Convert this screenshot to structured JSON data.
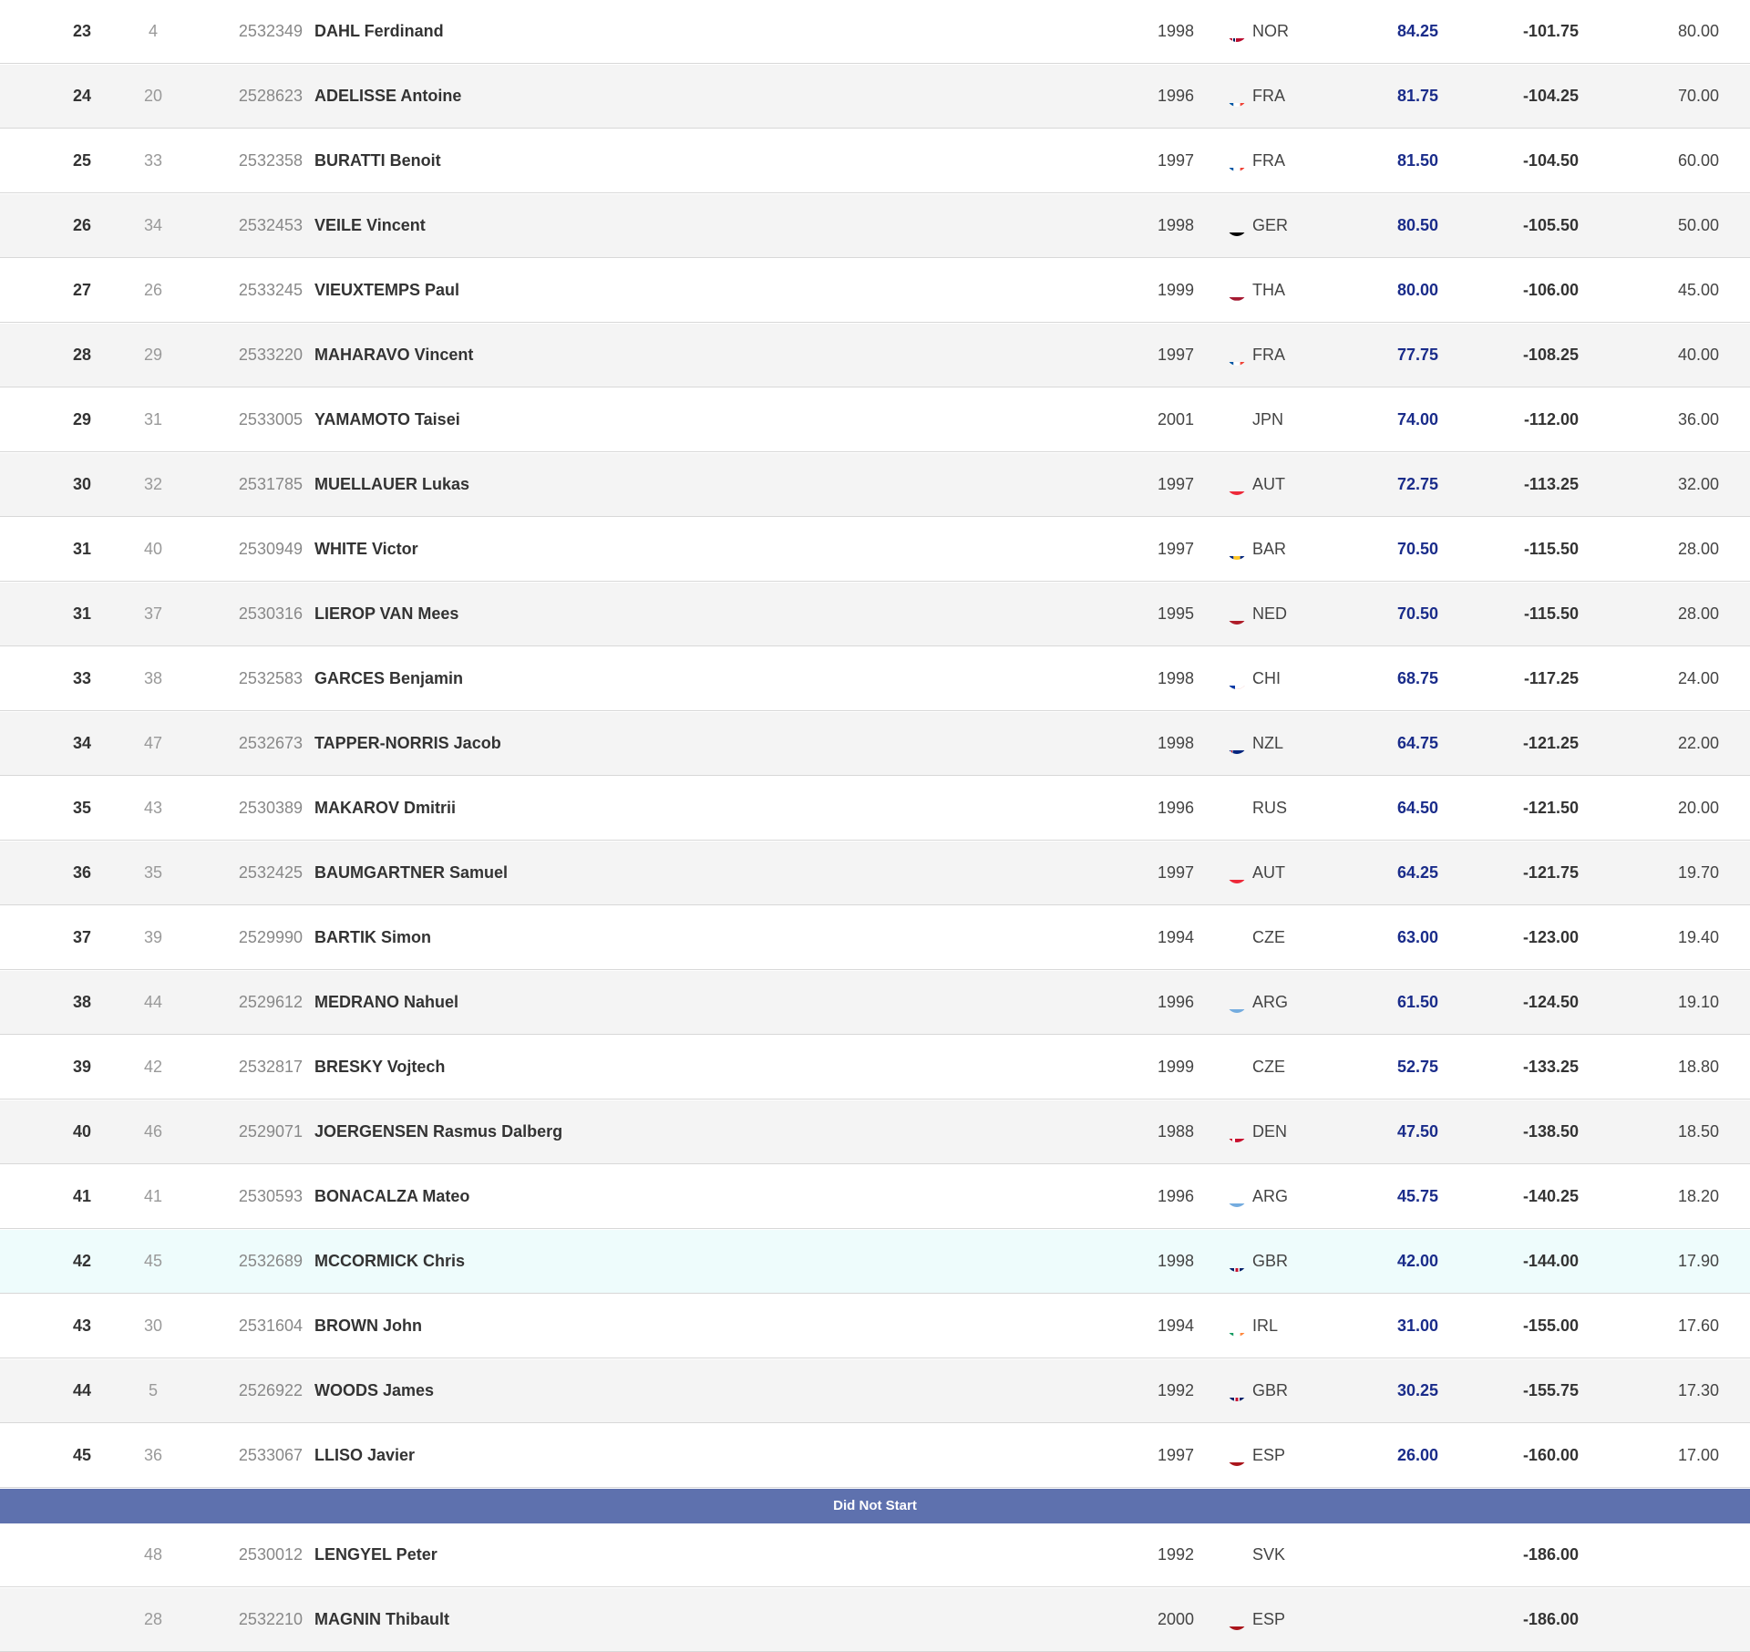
{
  "ranked": [
    {
      "rank": "23",
      "bib": "4",
      "code": "2532349",
      "name": "DAHL Ferdinand",
      "yob": "1998",
      "nation": "NOR",
      "points": "84.25",
      "diff": "-101.75",
      "fis": "80.00"
    },
    {
      "rank": "24",
      "bib": "20",
      "code": "2528623",
      "name": "ADELISSE Antoine",
      "yob": "1996",
      "nation": "FRA",
      "points": "81.75",
      "diff": "-104.25",
      "fis": "70.00"
    },
    {
      "rank": "25",
      "bib": "33",
      "code": "2532358",
      "name": "BURATTI Benoit",
      "yob": "1997",
      "nation": "FRA",
      "points": "81.50",
      "diff": "-104.50",
      "fis": "60.00"
    },
    {
      "rank": "26",
      "bib": "34",
      "code": "2532453",
      "name": "VEILE Vincent",
      "yob": "1998",
      "nation": "GER",
      "points": "80.50",
      "diff": "-105.50",
      "fis": "50.00"
    },
    {
      "rank": "27",
      "bib": "26",
      "code": "2533245",
      "name": "VIEUXTEMPS Paul",
      "yob": "1999",
      "nation": "THA",
      "points": "80.00",
      "diff": "-106.00",
      "fis": "45.00"
    },
    {
      "rank": "28",
      "bib": "29",
      "code": "2533220",
      "name": "MAHARAVO Vincent",
      "yob": "1997",
      "nation": "FRA",
      "points": "77.75",
      "diff": "-108.25",
      "fis": "40.00"
    },
    {
      "rank": "29",
      "bib": "31",
      "code": "2533005",
      "name": "YAMAMOTO Taisei",
      "yob": "2001",
      "nation": "JPN",
      "points": "74.00",
      "diff": "-112.00",
      "fis": "36.00"
    },
    {
      "rank": "30",
      "bib": "32",
      "code": "2531785",
      "name": "MUELLAUER Lukas",
      "yob": "1997",
      "nation": "AUT",
      "points": "72.75",
      "diff": "-113.25",
      "fis": "32.00"
    },
    {
      "rank": "31",
      "bib": "40",
      "code": "2530949",
      "name": "WHITE Victor",
      "yob": "1997",
      "nation": "BAR",
      "points": "70.50",
      "diff": "-115.50",
      "fis": "28.00"
    },
    {
      "rank": "31",
      "bib": "37",
      "code": "2530316",
      "name": "LIEROP VAN Mees",
      "yob": "1995",
      "nation": "NED",
      "points": "70.50",
      "diff": "-115.50",
      "fis": "28.00"
    },
    {
      "rank": "33",
      "bib": "38",
      "code": "2532583",
      "name": "GARCES Benjamin",
      "yob": "1998",
      "nation": "CHI",
      "points": "68.75",
      "diff": "-117.25",
      "fis": "24.00"
    },
    {
      "rank": "34",
      "bib": "47",
      "code": "2532673",
      "name": "TAPPER-NORRIS Jacob",
      "yob": "1998",
      "nation": "NZL",
      "points": "64.75",
      "diff": "-121.25",
      "fis": "22.00"
    },
    {
      "rank": "35",
      "bib": "43",
      "code": "2530389",
      "name": "MAKAROV Dmitrii",
      "yob": "1996",
      "nation": "RUS",
      "points": "64.50",
      "diff": "-121.50",
      "fis": "20.00"
    },
    {
      "rank": "36",
      "bib": "35",
      "code": "2532425",
      "name": "BAUMGARTNER Samuel",
      "yob": "1997",
      "nation": "AUT",
      "points": "64.25",
      "diff": "-121.75",
      "fis": "19.70"
    },
    {
      "rank": "37",
      "bib": "39",
      "code": "2529990",
      "name": "BARTIK Simon",
      "yob": "1994",
      "nation": "CZE",
      "points": "63.00",
      "diff": "-123.00",
      "fis": "19.40"
    },
    {
      "rank": "38",
      "bib": "44",
      "code": "2529612",
      "name": "MEDRANO Nahuel",
      "yob": "1996",
      "nation": "ARG",
      "points": "61.50",
      "diff": "-124.50",
      "fis": "19.10"
    },
    {
      "rank": "39",
      "bib": "42",
      "code": "2532817",
      "name": "BRESKY Vojtech",
      "yob": "1999",
      "nation": "CZE",
      "points": "52.75",
      "diff": "-133.25",
      "fis": "18.80"
    },
    {
      "rank": "40",
      "bib": "46",
      "code": "2529071",
      "name": "JOERGENSEN Rasmus Dalberg",
      "yob": "1988",
      "nation": "DEN",
      "points": "47.50",
      "diff": "-138.50",
      "fis": "18.50"
    },
    {
      "rank": "41",
      "bib": "41",
      "code": "2530593",
      "name": "BONACALZA Mateo",
      "yob": "1996",
      "nation": "ARG",
      "points": "45.75",
      "diff": "-140.25",
      "fis": "18.20"
    },
    {
      "rank": "42",
      "bib": "45",
      "code": "2532689",
      "name": "MCCORMICK Chris",
      "yob": "1998",
      "nation": "GBR",
      "points": "42.00",
      "diff": "-144.00",
      "fis": "17.90",
      "highlight": true
    },
    {
      "rank": "43",
      "bib": "30",
      "code": "2531604",
      "name": "BROWN John",
      "yob": "1994",
      "nation": "IRL",
      "points": "31.00",
      "diff": "-155.00",
      "fis": "17.60"
    },
    {
      "rank": "44",
      "bib": "5",
      "code": "2526922",
      "name": "WOODS James",
      "yob": "1992",
      "nation": "GBR",
      "points": "30.25",
      "diff": "-155.75",
      "fis": "17.30"
    },
    {
      "rank": "45",
      "bib": "36",
      "code": "2533067",
      "name": "LLISO Javier",
      "yob": "1997",
      "nation": "ESP",
      "points": "26.00",
      "diff": "-160.00",
      "fis": "17.00"
    }
  ],
  "dns_label": "Did Not Start",
  "dns": [
    {
      "rank": "",
      "bib": "48",
      "code": "2530012",
      "name": "LENGYEL Peter",
      "yob": "1992",
      "nation": "SVK",
      "points": "",
      "diff": "-186.00",
      "fis": ""
    },
    {
      "rank": "",
      "bib": "28",
      "code": "2532210",
      "name": "MAGNIN Thibault",
      "yob": "2000",
      "nation": "ESP",
      "points": "",
      "diff": "-186.00",
      "fis": ""
    }
  ],
  "colors": {
    "points": "#1a2c8a",
    "dns_bar": "#5e71ae",
    "highlight_row": "#eefcfc"
  }
}
